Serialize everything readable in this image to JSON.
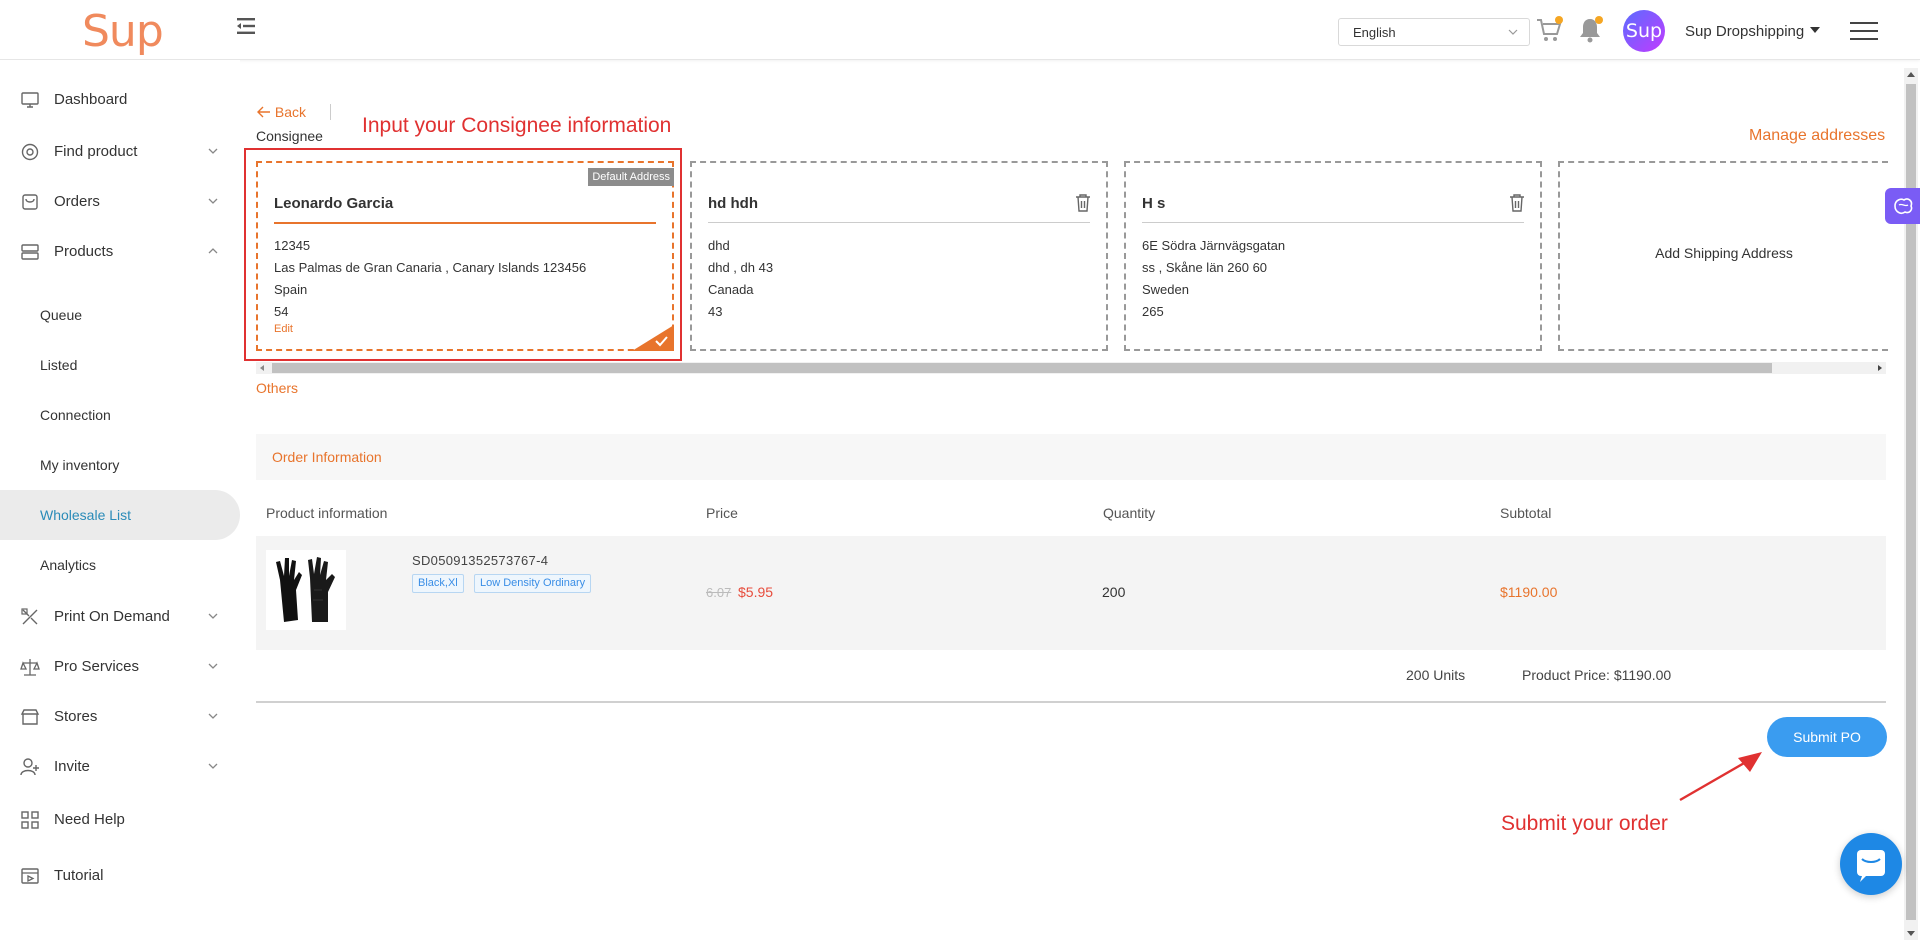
{
  "header": {
    "logo": "Sup",
    "language": "English",
    "avatar_text": "Sup",
    "user_name": "Sup Dropshipping"
  },
  "sidebar": {
    "items": [
      {
        "label": "Dashboard",
        "icon": "monitor-icon"
      },
      {
        "label": "Find product",
        "icon": "search-icon"
      },
      {
        "label": "Orders",
        "icon": "bag-icon"
      },
      {
        "label": "Products",
        "icon": "box-icon"
      },
      {
        "label": "Print On Demand",
        "icon": "brush-icon"
      },
      {
        "label": "Pro Services",
        "icon": "scale-icon"
      },
      {
        "label": "Stores",
        "icon": "store-icon"
      },
      {
        "label": "Invite",
        "icon": "user-add-icon"
      },
      {
        "label": "Need Help",
        "icon": "grid-icon"
      },
      {
        "label": "Tutorial",
        "icon": "video-icon"
      }
    ],
    "products_sub": [
      "Queue",
      "Listed",
      "Connection",
      "My inventory",
      "Wholesale List",
      "Analytics"
    ],
    "active_sub": "Wholesale List"
  },
  "page": {
    "back": "Back",
    "consignee_label": "Consignee",
    "manage_addresses": "Manage addresses",
    "others": "Others",
    "annotation_top": "Input your Consignee information",
    "annotation_bottom": "Submit your order"
  },
  "addresses": [
    {
      "name": "Leonardo Garcia",
      "lines": [
        "12345",
        "Las Palmas de Gran Canaria , Canary Islands 123456",
        "Spain",
        "54"
      ],
      "badge": "Default Address",
      "edit": "Edit"
    },
    {
      "name": "hd hdh",
      "lines": [
        "dhd",
        "dhd , dh 43",
        "Canada",
        "43"
      ]
    },
    {
      "name": "H s",
      "lines": [
        "6E Södra Järnvägsgatan",
        "ss , Skåne län 260 60",
        "Sweden",
        "265"
      ]
    }
  ],
  "add_address": "Add Shipping Address",
  "order": {
    "section_title": "Order Information",
    "columns": [
      "Product information",
      "Price",
      "Quantity",
      "Subtotal"
    ],
    "item": {
      "sku": "SD05091352573767-4",
      "tags": [
        "Black,Xl",
        "Low Density Ordinary"
      ],
      "old_price": "6.07",
      "price": "$5.95",
      "quantity": "200",
      "subtotal": "$1190.00"
    },
    "units": "200 Units",
    "product_price": "Product Price: $1190.00",
    "submit": "Submit PO"
  },
  "colors": {
    "accent": "#e8742c",
    "primary": "#3a9cf0",
    "annotation": "#e03131"
  }
}
